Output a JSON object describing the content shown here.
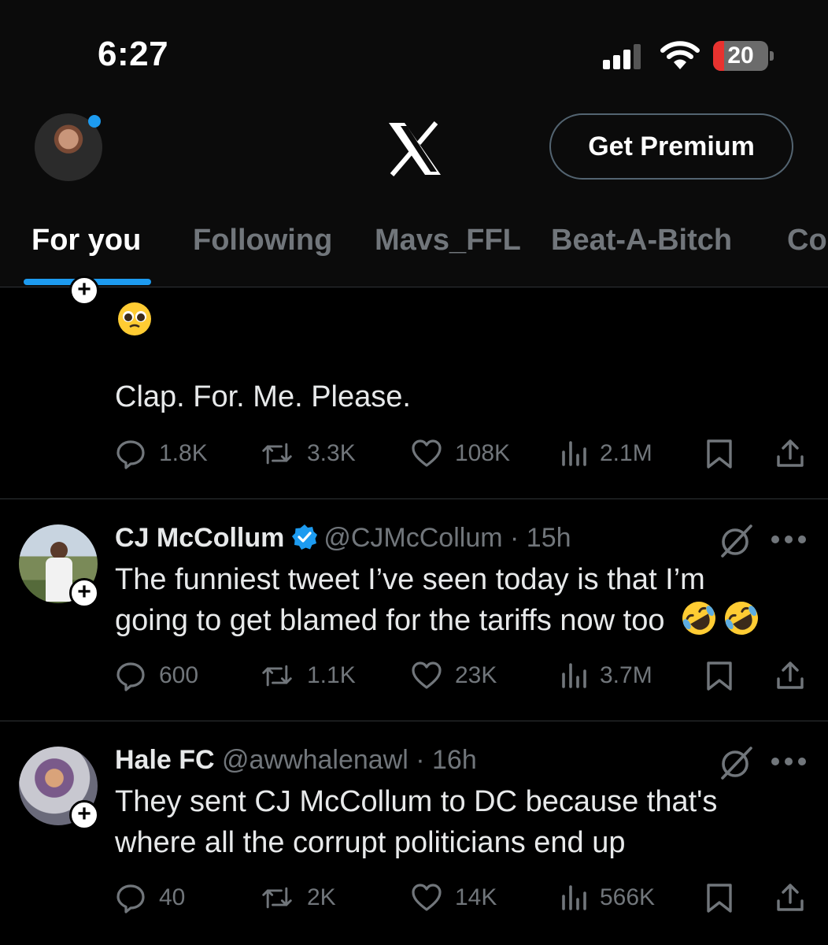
{
  "status_bar": {
    "time": "6:27",
    "battery_level": "20"
  },
  "header": {
    "logo": "x-logo",
    "premium_button": "Get Premium"
  },
  "tabs": [
    {
      "label": "For you",
      "active": true
    },
    {
      "label": "Following",
      "active": false
    },
    {
      "label": "Mavs_FFL",
      "active": false
    },
    {
      "label": "Beat-A-Bitch",
      "active": false
    },
    {
      "label": "Co",
      "active": false
    }
  ],
  "tweets": [
    {
      "body_line": "Clap. For. Me. Please.",
      "stats": {
        "replies": "1.8K",
        "reposts": "3.3K",
        "likes": "108K",
        "views": "2.1M"
      }
    },
    {
      "name": "CJ McCollum",
      "handle": "@CJMcCollum",
      "time": "· 15h",
      "text_line1": "The funniest tweet I’ve seen today is that I’m",
      "text_line2": "going to get blamed for the tariffs now too",
      "stats": {
        "replies": "600",
        "reposts": "1.1K",
        "likes": "23K",
        "views": "3.7M"
      }
    },
    {
      "name": "Hale FC",
      "handle": "@awwhalenawl",
      "time": "· 16h",
      "text_line1": "They sent CJ McCollum to DC because that's",
      "text_line2": "where all the corrupt politicians end up",
      "stats": {
        "replies": "40",
        "reposts": "2K",
        "likes": "14K",
        "views": "566K"
      }
    }
  ],
  "colors": {
    "accent": "#1d9bf0",
    "muted": "#71767b",
    "divider": "#2f3336",
    "battery": "#e8322f"
  }
}
